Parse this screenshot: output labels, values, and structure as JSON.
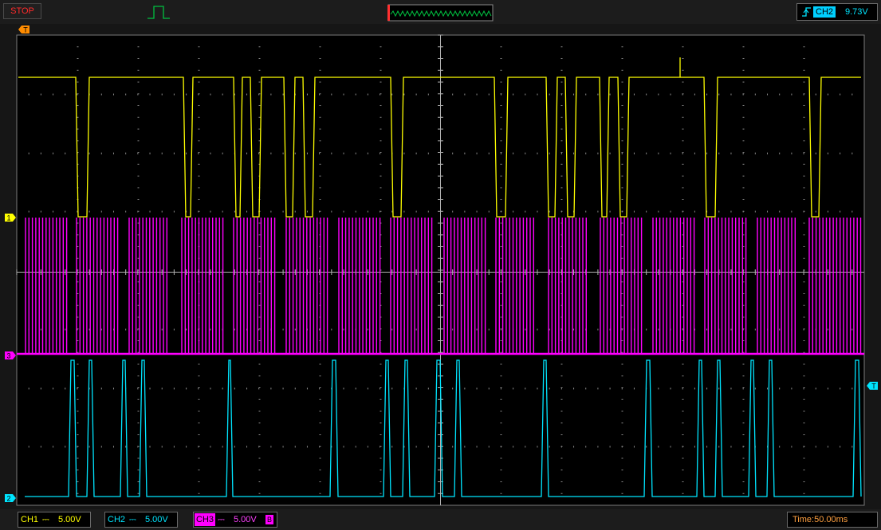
{
  "status": {
    "label": "STOP"
  },
  "trigger": {
    "channel": "CH2",
    "level": "9.73V"
  },
  "markers": {
    "trigger_pos": "T",
    "ch1": "1",
    "ch2": "2",
    "ch3": "3",
    "trigger_level": "T"
  },
  "channels": [
    {
      "name": "CH1",
      "coupling": "⎓",
      "scale": "5.00V",
      "color": "#ffff00"
    },
    {
      "name": "CH2",
      "coupling": "⎓",
      "scale": "5.00V",
      "color": "#00e5ff"
    },
    {
      "name": "CH3",
      "coupling": "⎓",
      "scale": "5.00V",
      "color": "#ff00ff",
      "badge": "B"
    }
  ],
  "timebase": {
    "label": "Time:50.00ms"
  }
}
